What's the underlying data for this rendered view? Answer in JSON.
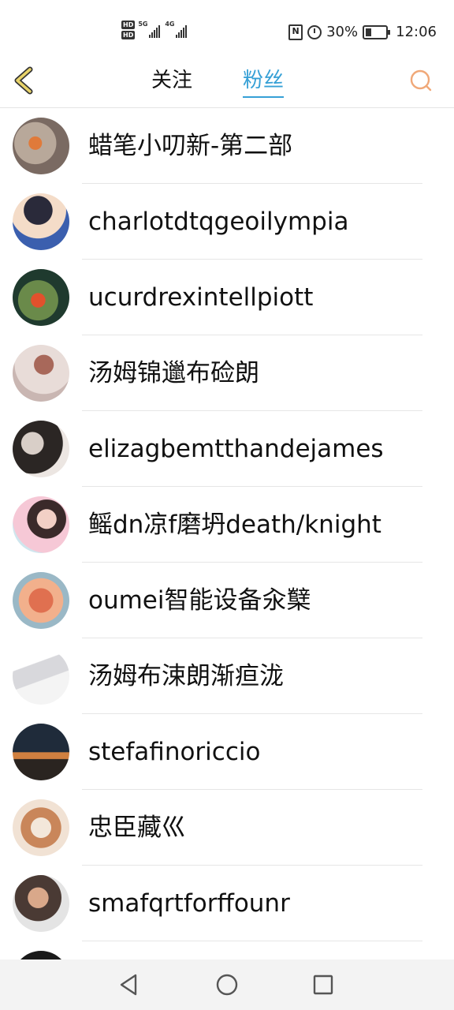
{
  "status_bar": {
    "sim1": "HD",
    "sim2": "HD",
    "network1": "5G",
    "network2": "4G",
    "nfc": "N",
    "battery_percent": "30%",
    "time": "12:06"
  },
  "header": {
    "back_icon": "chevron-left-icon",
    "tabs": [
      {
        "label": "关注",
        "active": false
      },
      {
        "label": "粉丝",
        "active": true
      }
    ],
    "search_icon": "search-icon",
    "accent_color": "#36a0d6"
  },
  "fans": [
    {
      "name": "蜡笔小叨新-第二部"
    },
    {
      "name": "charlotdtqgeoilympia"
    },
    {
      "name": "ucurdrexintellpiott"
    },
    {
      "name": "汤姆锦邋布硷朗"
    },
    {
      "name": "elizagbemtthandejames"
    },
    {
      "name": "鳐dn凉f磨坍death/knight"
    },
    {
      "name": "oumei智能设备汆櫱"
    },
    {
      "name": "汤姆布涑朗渐疸泷"
    },
    {
      "name": "stefafinoriccio"
    },
    {
      "name": "忠臣藏巛"
    },
    {
      "name": "smafqrtforffounr"
    }
  ],
  "nav_bar": {
    "back_icon": "triangle-back-icon",
    "home_icon": "circle-home-icon",
    "recents_icon": "square-recents-icon"
  }
}
